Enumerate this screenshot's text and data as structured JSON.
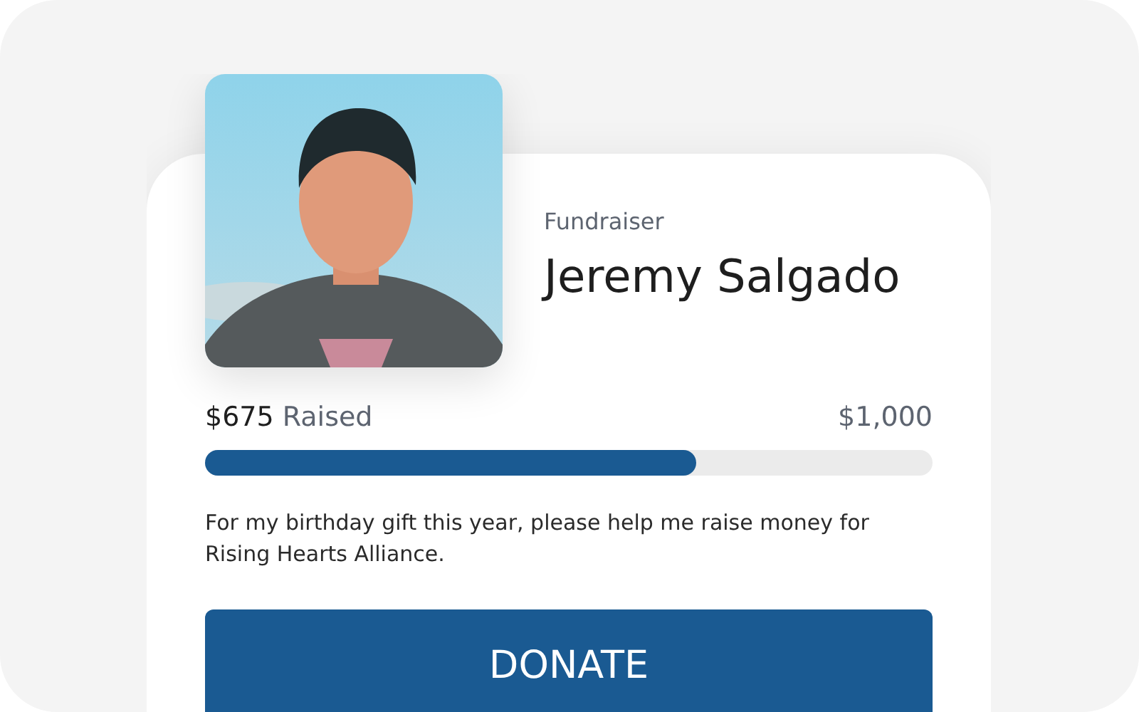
{
  "fundraiser": {
    "role": "Fundraiser",
    "name": "Jeremy Salgado"
  },
  "progress": {
    "raised_amount": "$675",
    "raised_label": "Raised",
    "goal": "$1,000",
    "level": 0.676
  },
  "description": "For my birthday gift this year, please help me raise money for Rising Hearts Alliance.",
  "donate_button": {
    "label": "DONATE"
  }
}
